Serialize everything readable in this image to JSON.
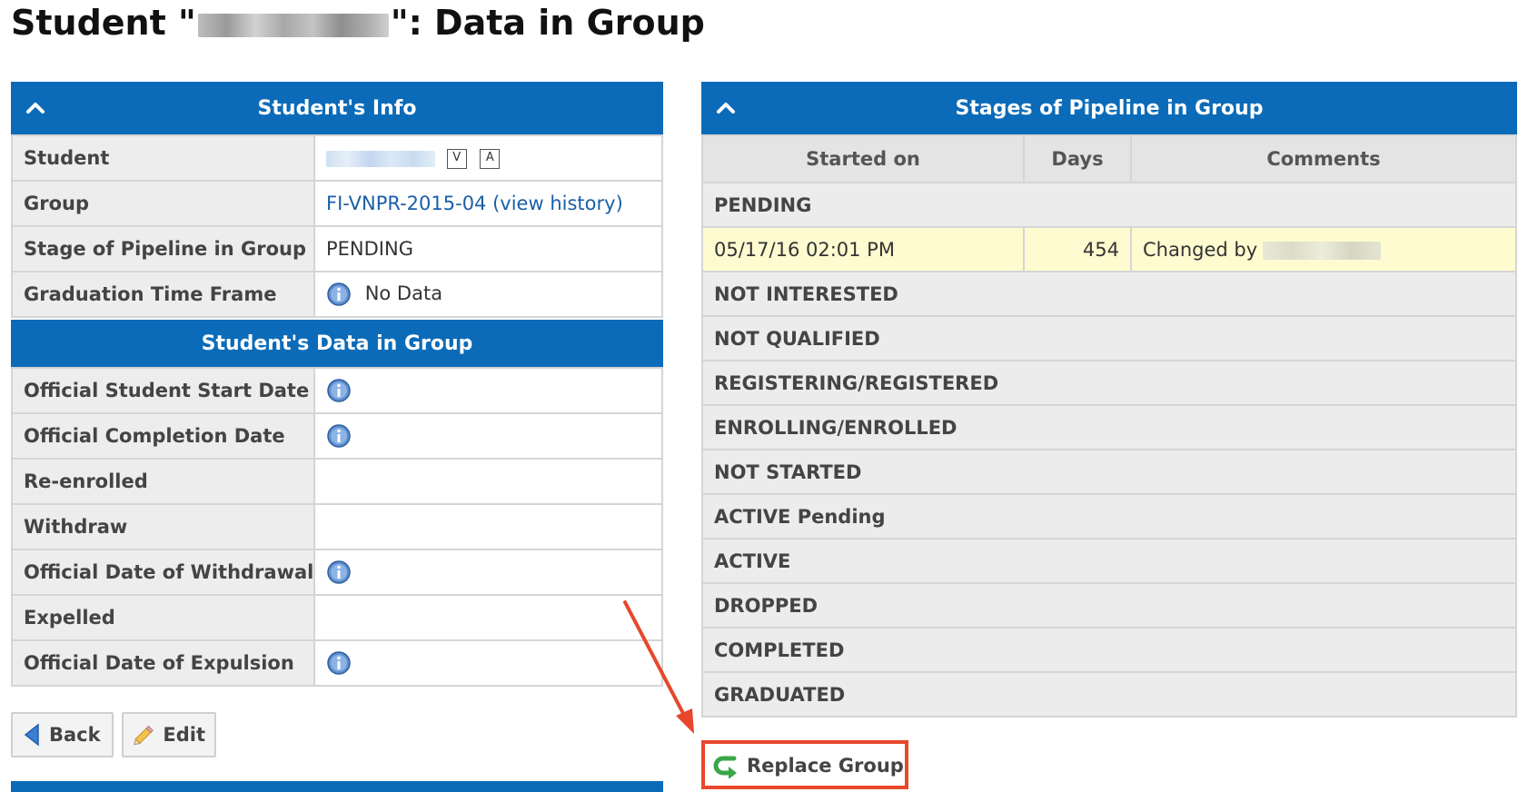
{
  "page": {
    "title_prefix": "Student \"",
    "title_suffix": "\": Data in Group"
  },
  "student_info": {
    "header": "Student's Info",
    "rows": {
      "student": {
        "label": "Student",
        "v_btn": "V",
        "a_btn": "A"
      },
      "group": {
        "label": "Group",
        "group_link": "FI-VNPR-2015-04",
        "open_paren": " (",
        "history_link": "view history",
        "close_paren": ")"
      },
      "stage": {
        "label": "Stage of Pipeline in Group",
        "value": "PENDING"
      },
      "graduation": {
        "label": "Graduation Time Frame",
        "value": "No Data"
      }
    }
  },
  "student_data": {
    "header": "Student's Data in Group",
    "rows": [
      {
        "label": "Official Student Start Date"
      },
      {
        "label": "Official Completion Date"
      },
      {
        "label": "Re-enrolled"
      },
      {
        "label": "Withdraw"
      },
      {
        "label": "Official Date of Withdrawal"
      },
      {
        "label": "Expelled"
      },
      {
        "label": "Official Date of Expulsion"
      }
    ]
  },
  "actions": {
    "back_label": "Back",
    "edit_label": "Edit",
    "replace_group_label": "Replace Group"
  },
  "pipeline": {
    "header": "Stages of Pipeline in Group",
    "columns": [
      "Started on",
      "Days",
      "Comments"
    ],
    "pending_stage": "PENDING",
    "history": {
      "started_on": "05/17/16 02:01 PM",
      "days": "454",
      "comment_prefix": "Changed by"
    },
    "other_stages": [
      "NOT INTERESTED",
      "NOT QUALIFIED",
      "REGISTERING/REGISTERED",
      "ENROLLING/ENROLLED",
      "NOT STARTED",
      "ACTIVE Pending",
      "ACTIVE",
      "DROPPED",
      "COMPLETED",
      "GRADUATED"
    ]
  },
  "colors": {
    "header_blue": "#0b6bb8",
    "highlight_row": "#fefbd0",
    "annotation_red": "#e8472c",
    "link_blue": "#1a5fa8"
  },
  "icons": {
    "collapse": "chevron-up-icon",
    "info": "info-icon",
    "back": "triangle-left-icon",
    "edit": "pencil-icon",
    "replace": "green-return-arrow-icon"
  }
}
